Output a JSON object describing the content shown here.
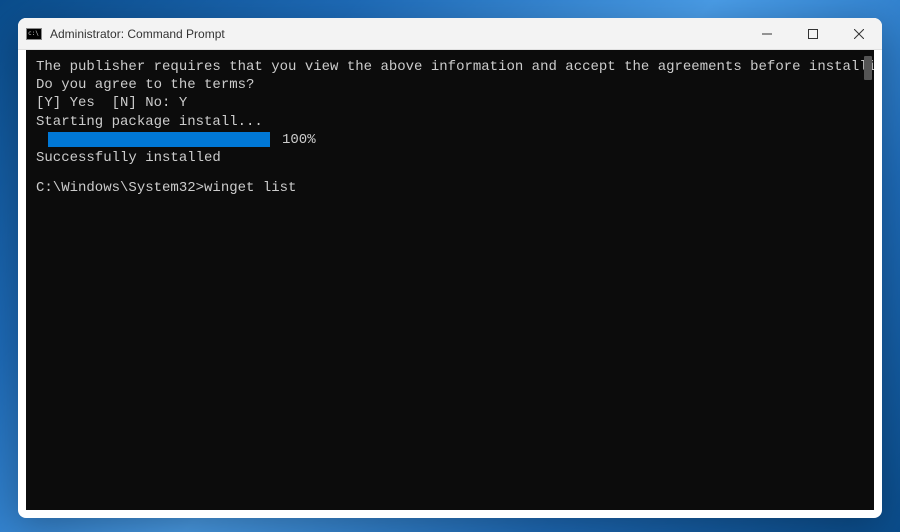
{
  "window": {
    "title": "Administrator: Command Prompt"
  },
  "terminal": {
    "line1": "The publisher requires that you view the above information and accept the agreements before installing.",
    "line2": "Do you agree to the terms?",
    "line3": "[Y] Yes  [N] No: Y",
    "line4": "Starting package install...",
    "progress_pct": "100%",
    "line5": "Successfully installed",
    "prompt_path": "C:\\Windows\\System32>",
    "command": "winget list"
  }
}
